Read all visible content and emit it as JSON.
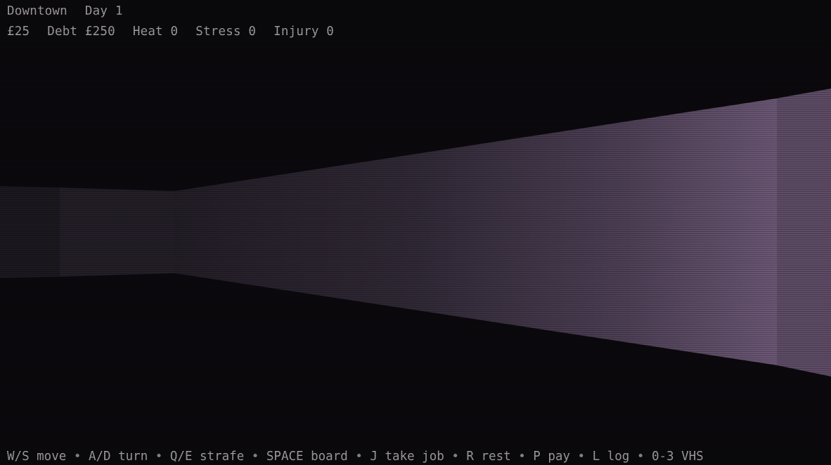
{
  "hud": {
    "location": "Downtown",
    "day": "Day 1",
    "money": "£25",
    "debt": "Debt £250",
    "heat": "Heat 0",
    "stress": "Stress 0",
    "injury": "Injury 0"
  },
  "controls": {
    "move": "W/S move",
    "turn": "A/D turn",
    "strafe": "Q/E strafe",
    "board": "SPACE board",
    "take_job": "J take job",
    "rest": "R rest",
    "pay": "P pay",
    "log": "L log",
    "vhs": "0-3 VHS",
    "separator": "•"
  },
  "colors": {
    "background": "#0a080c",
    "hud_text": "#a59ea6",
    "wall_far": "#2a2530",
    "wall_near": "#6f5a78"
  }
}
